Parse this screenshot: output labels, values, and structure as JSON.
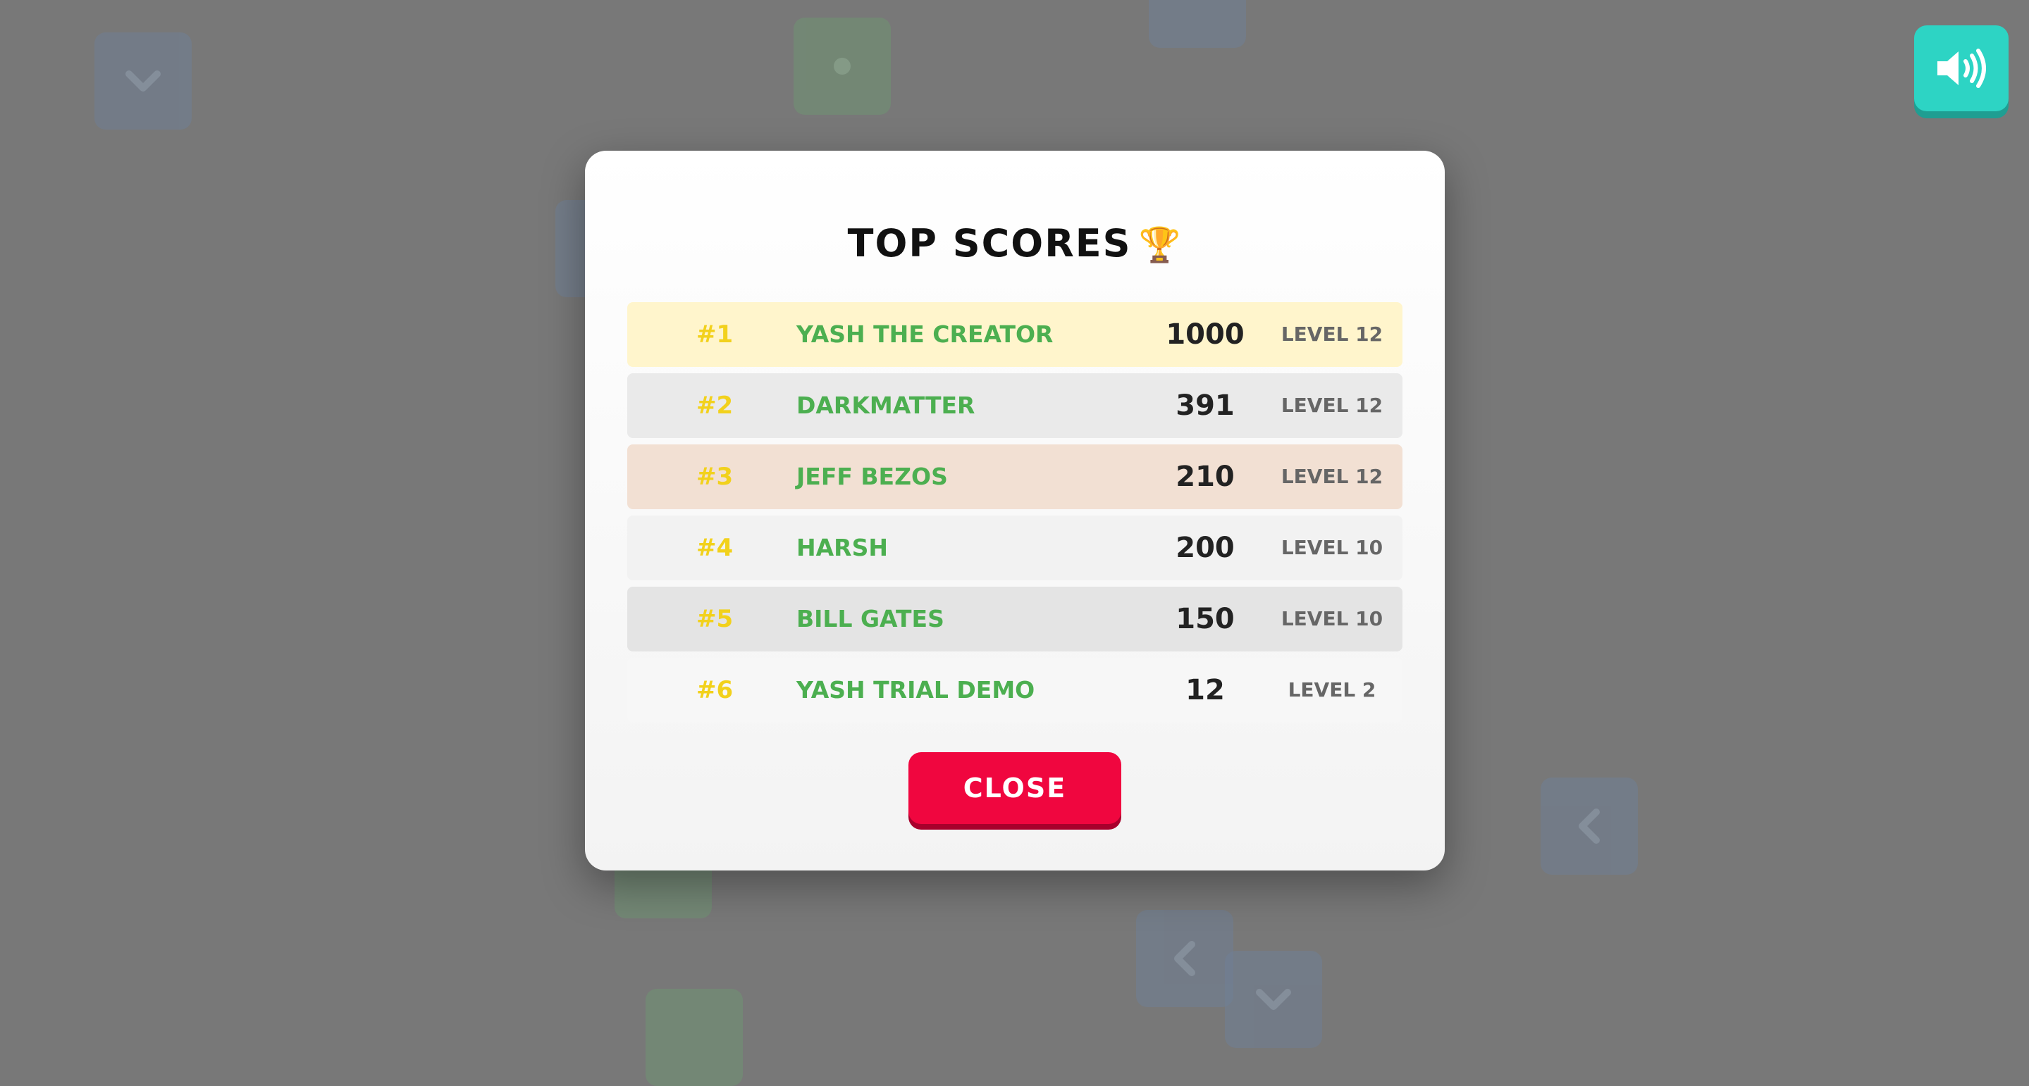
{
  "colors": {
    "backdrop": "#787878",
    "modal_bg": "#ffffff",
    "rank": "#f2d11c",
    "name": "#4caf50",
    "score": "#222222",
    "level": "#666666",
    "close_button": "#f0063f",
    "sound_button": "#2dd4c4"
  },
  "sound_button": {
    "icon": "speaker-volume-icon"
  },
  "modal": {
    "title": "TOP SCORES",
    "title_icon": "🏆",
    "rows": [
      {
        "rank": "#1",
        "name": "YASH THE CREATOR",
        "score": "1000",
        "level": "LEVEL 12",
        "bg": "#fff5cc"
      },
      {
        "rank": "#2",
        "name": "DARKMATTER",
        "score": "391",
        "level": "LEVEL 12",
        "bg": "#eaeaea"
      },
      {
        "rank": "#3",
        "name": "JEFF BEZOS",
        "score": "210",
        "level": "LEVEL 12",
        "bg": "#f2e0d3"
      },
      {
        "rank": "#4",
        "name": "HARSH",
        "score": "200",
        "level": "LEVEL 10",
        "bg": "#f2f2f2"
      },
      {
        "rank": "#5",
        "name": "BILL GATES",
        "score": "150",
        "level": "LEVEL 10",
        "bg": "#e4e4e4"
      },
      {
        "rank": "#6",
        "name": "YASH TRIAL DEMO",
        "score": "12",
        "level": "LEVEL 2",
        "bg": "#f7f7f7"
      }
    ],
    "close_label": "CLOSE"
  }
}
